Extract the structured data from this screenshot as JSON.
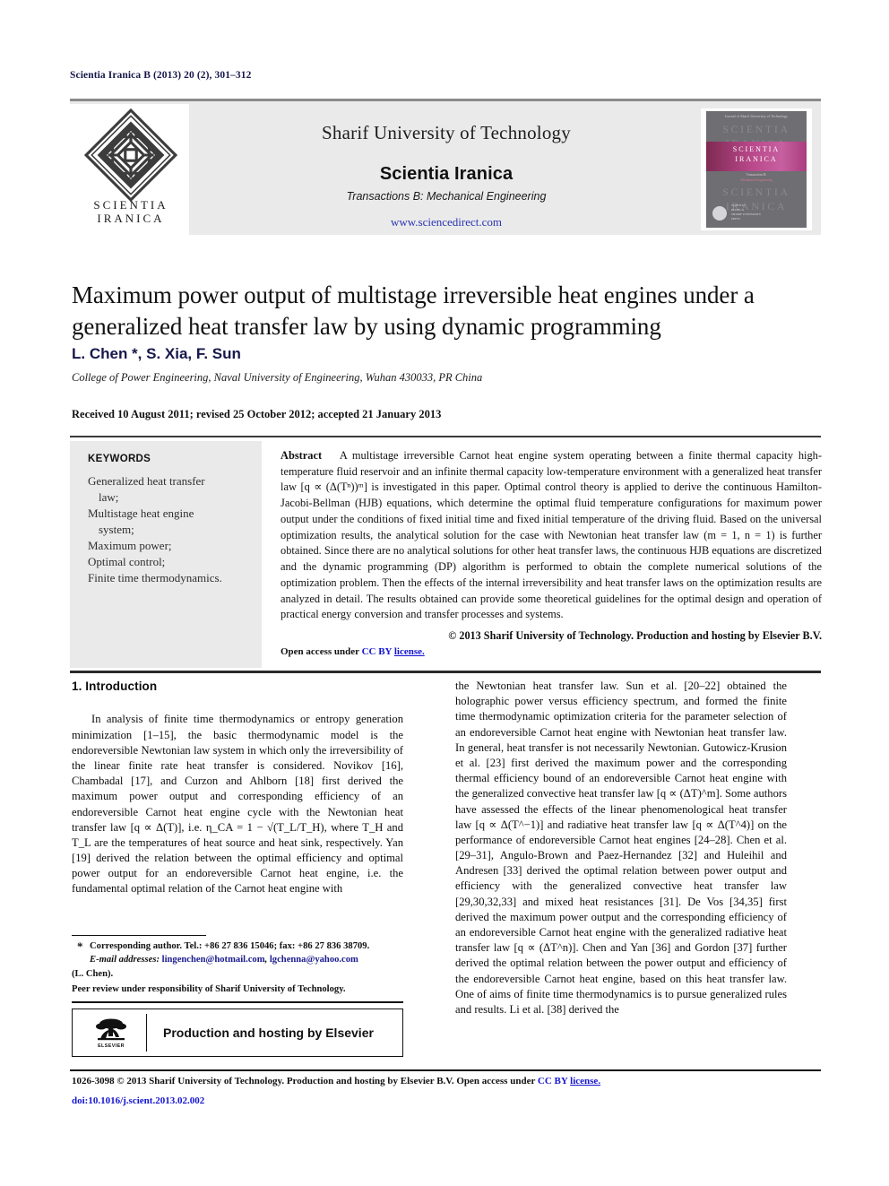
{
  "running_head": "Scientia Iranica B (2013) 20 (2), 301–312",
  "masthead": {
    "logo_text_line1": "SCIENTIA",
    "logo_text_line2": "IRANICA",
    "logo_icon": "scientia-iranica-diamond-logo",
    "university": "Sharif University of Technology",
    "journal": "Scientia Iranica",
    "transactions": "Transactions B: Mechanical Engineering",
    "url": "www.sciencedirect.com",
    "cover": {
      "top_line": "Journal of Sharif University of Technology",
      "ghost_line": "SCIENTIA",
      "ghost_line2": "IRANICA",
      "band_line1": "SCIENTIA",
      "band_line2": "IRANICA",
      "band_sub1": "Transactions B:",
      "band_sub2": "Mechanical Engineering",
      "foot_line1": "SCIENTIA",
      "foot_line2": "IRANICA",
      "foot_line3": "SHARIF UNIVERSITY",
      "foot_line4": "PRESS"
    }
  },
  "article": {
    "title": "Maximum power output of multistage irreversible heat engines under a generalized heat transfer law by using dynamic programming",
    "authors": "L. Chen *, S. Xia, F. Sun",
    "affiliation": "College of Power Engineering, Naval University of Engineering, Wuhan 430033, PR China",
    "history": "Received 10 August 2011; revised 25 October 2012; accepted 21 January 2013"
  },
  "keywords": {
    "heading": "KEYWORDS",
    "items": [
      "Generalized heat transfer",
      "law;",
      "Multistage heat engine",
      "system;",
      "Maximum power;",
      "Optimal control;",
      "Finite time thermodynamics."
    ]
  },
  "abstract": {
    "label": "Abstract",
    "text": "A multistage irreversible Carnot heat engine system operating between a finite thermal capacity high-temperature fluid reservoir and an infinite thermal capacity low-temperature environment with a generalized heat transfer law [q ∝ (Δ(Tⁿ))ᵐ] is investigated in this paper. Optimal control theory is applied to derive the continuous Hamilton-Jacobi-Bellman (HJB) equations, which determine the optimal fluid temperature configurations for maximum power output under the conditions of fixed initial time and fixed initial temperature of the driving fluid. Based on the universal optimization results, the analytical solution for the case with Newtonian heat transfer law (m = 1, n = 1) is further obtained. Since there are no analytical solutions for other heat transfer laws, the continuous HJB equations are discretized and the dynamic programming (DP) algorithm is performed to obtain the complete numerical solutions of the optimization problem. Then the effects of the internal irreversibility and heat transfer laws on the optimization results are analyzed in detail. The results obtained can provide some theoretical guidelines for the optimal design and operation of practical energy conversion and transfer processes and systems.",
    "copyright": "© 2013 Sharif University of Technology. Production and hosting by Elsevier B.V.",
    "open_access_prefix": "Open access under ",
    "open_access_ccby": "CC BY",
    "open_access_license": "license."
  },
  "body": {
    "section_heading": "1. Introduction",
    "left_paragraph": "In analysis of finite time thermodynamics or entropy generation minimization [1–15], the basic thermodynamic model is the endoreversible Newtonian law system in which only the irreversibility of the linear finite rate heat transfer is considered. Novikov [16], Chambadal [17], and Curzon and Ahlborn [18] first derived the maximum power output and corresponding efficiency of an endoreversible Carnot heat engine cycle with the Newtonian heat transfer law [q ∝ Δ(T)], i.e. η_CA = 1 − √(T_L/T_H), where T_H and T_L are the temperatures of heat source and heat sink, respectively. Yan [19] derived the relation between the optimal efficiency and optimal power output for an endoreversible Carnot heat engine, i.e. the fundamental optimal relation of the Carnot heat engine with",
    "right_paragraph": "the Newtonian heat transfer law. Sun et al. [20–22] obtained the holographic power versus efficiency spectrum, and formed the finite time thermodynamic optimization criteria for the parameter selection of an endoreversible Carnot heat engine with Newtonian heat transfer law. In general, heat transfer is not necessarily Newtonian. Gutowicz-Krusion et al. [23] first derived the maximum power and the corresponding thermal efficiency bound of an endoreversible Carnot heat engine with the generalized convective heat transfer law [q ∝ (ΔT)^m]. Some authors have assessed the effects of the linear phenomenological heat transfer law [q ∝ Δ(T^−1)] and radiative heat transfer law [q ∝ Δ(T^4)] on the performance of endoreversible Carnot heat engines [24–28]. Chen et al. [29–31], Angulo-Brown and Paez-Hernandez [32] and Huleihil and Andresen [33] derived the optimal relation between power output and efficiency with the generalized convective heat transfer law [29,30,32,33] and mixed heat resistances [31]. De Vos [34,35] first derived the maximum power output and the corresponding efficiency of an endoreversible Carnot heat engine with the generalized radiative heat transfer law [q ∝ (ΔT^n)]. Chen and Yan [36] and Gordon [37] further derived the optimal relation between the power output and efficiency of the endoreversible Carnot heat engine, based on this heat transfer law. One of aims of finite time thermodynamics is to pursue generalized rules and results. Li et al. [38] derived the"
  },
  "footnotes": {
    "corresponding": "Corresponding author. Tel.: +86 27 836 15046; fax: +86 27 836 38709.",
    "emails_label": "E-mail addresses:",
    "email1": "lingenchen@hotmail.com",
    "email_sep": ", ",
    "email2": "lgchenna@yahoo.com",
    "email_owner": "(L. Chen).",
    "peer_review": "Peer review under responsibility of Sharif University of Technology.",
    "elsevier_box_text": "Production and hosting by Elsevier",
    "elsevier_word": "ELSEVIER",
    "elsevier_icon": "elsevier-tree-logo"
  },
  "page_footer": {
    "issn_line_prefix": "1026-3098 © 2013 Sharif University of Technology. Production and hosting by Elsevier B.V.  Open access under ",
    "issn_ccby": "CC BY",
    "issn_license": "license.",
    "doi": "doi:10.1016/j.scient.2013.02.002"
  },
  "colors": {
    "link_blue": "#2b35b4",
    "ref_blue": "#1b1b8f",
    "masthead_gray": "#eaeaea",
    "cover_gray": "#6e6e73",
    "cover_magenta": "#b9488a",
    "title_black": "#121212"
  }
}
